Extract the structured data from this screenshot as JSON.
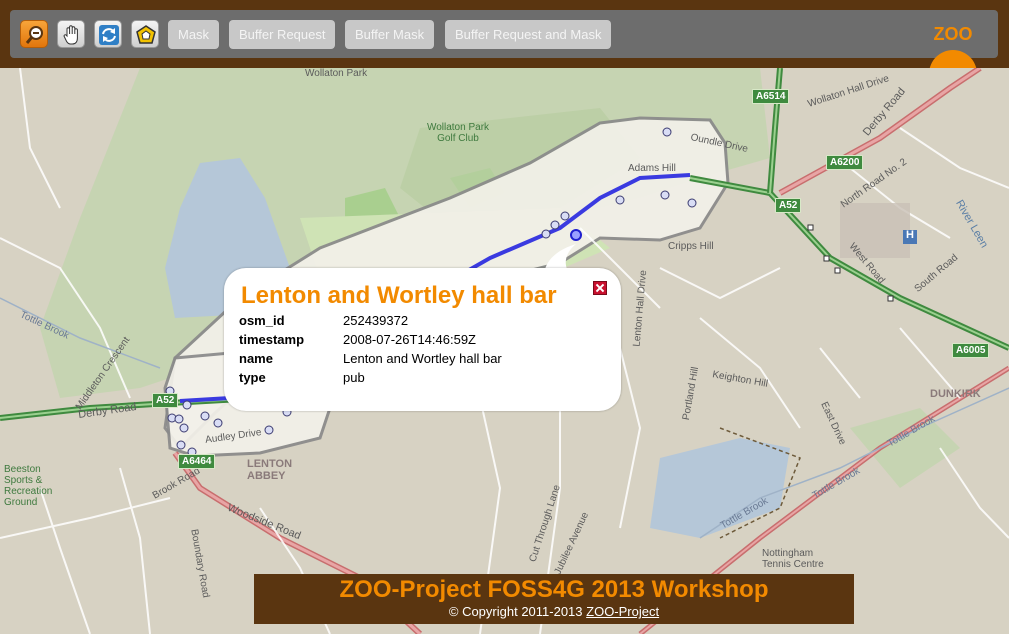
{
  "toolbar": {
    "tools": [
      {
        "icon": "zoom-box-icon",
        "active": true
      },
      {
        "icon": "pan-hand-icon",
        "active": false
      },
      {
        "icon": "refresh-icon",
        "active": false
      },
      {
        "icon": "polygon-select-icon",
        "active": false
      }
    ],
    "buttons": {
      "mask": "Mask",
      "buffer_request": "Buffer Request",
      "buffer_mask": "Buffer Mask",
      "buffer_request_and_mask": "Buffer Request and Mask"
    },
    "logo_text": "ZOO"
  },
  "map": {
    "labels": {
      "wollaton_park": "Wollaton Park",
      "golf_club": "Wollaton Park Golf Club",
      "oundle_drive": "Oundle Drive",
      "adams_hill": "Adams Hill",
      "cripps_hill": "Cripps Hill",
      "wollaton_hall_drive": "Wollaton Hall Drive",
      "derby_road_ne": "Derby Road",
      "derby_road_w": "Derby Road",
      "tottle_brook_w": "Tottle Brook",
      "tottle_brook_e1": "Tottle Brook",
      "tottle_brook_e2": "Tottle Brook",
      "tottle_brook_e3": "Tottle Brook",
      "lenton_abbey": "LENTON ABBEY",
      "dunkirk": "DUNKIRK",
      "river_leen": "River Leen",
      "beeston_rec": "Beeston Sports & Recreation Ground",
      "woodside_road": "Woodside Road",
      "keighton_hill": "Keighton Hill",
      "east_drive": "East Drive",
      "south_road": "South Road",
      "west_road": "West Road",
      "north_road": "North Road No. 2",
      "audley_drive": "Audley Drive",
      "brook_road": "Brook Road",
      "boundary_road": "Boundary Road",
      "nottingham_tennis": "Nottingham Tennis Centre",
      "jubilee_avenue": "Jubilee Avenue",
      "cut_through_lane": "Cut Through Lane",
      "middleton_crescent": "Middleton Crescent",
      "lenton_hall_drive": "Lenton Hall Drive",
      "portland_hill": "Portland Hill",
      "hospital_marker": "H"
    },
    "shields": {
      "a6514": "A6514",
      "a6200": "A6200",
      "a52_east": "A52",
      "a52_west": "A52",
      "a6464": "A6464",
      "a6005": "A6005"
    }
  },
  "popup": {
    "title": "Lenton and Wortley hall bar",
    "attributes": [
      {
        "key": "osm_id",
        "value": "252439372"
      },
      {
        "key": "timestamp",
        "value": "2008-07-26T14:46:59Z"
      },
      {
        "key": "name",
        "value": "Lenton and Wortley hall bar"
      },
      {
        "key": "type",
        "value": "pub"
      }
    ]
  },
  "footer": {
    "title": "ZOO-Project FOSS4G 2013 Workshop",
    "copyright_prefix": "© Copyright 2011-2013 ",
    "link_text": "ZOO-Project"
  },
  "colors": {
    "brown": "#5a3510",
    "orange": "#f28a00",
    "route_blue": "#3a3ae0",
    "road_green": "#3f8a3f"
  }
}
